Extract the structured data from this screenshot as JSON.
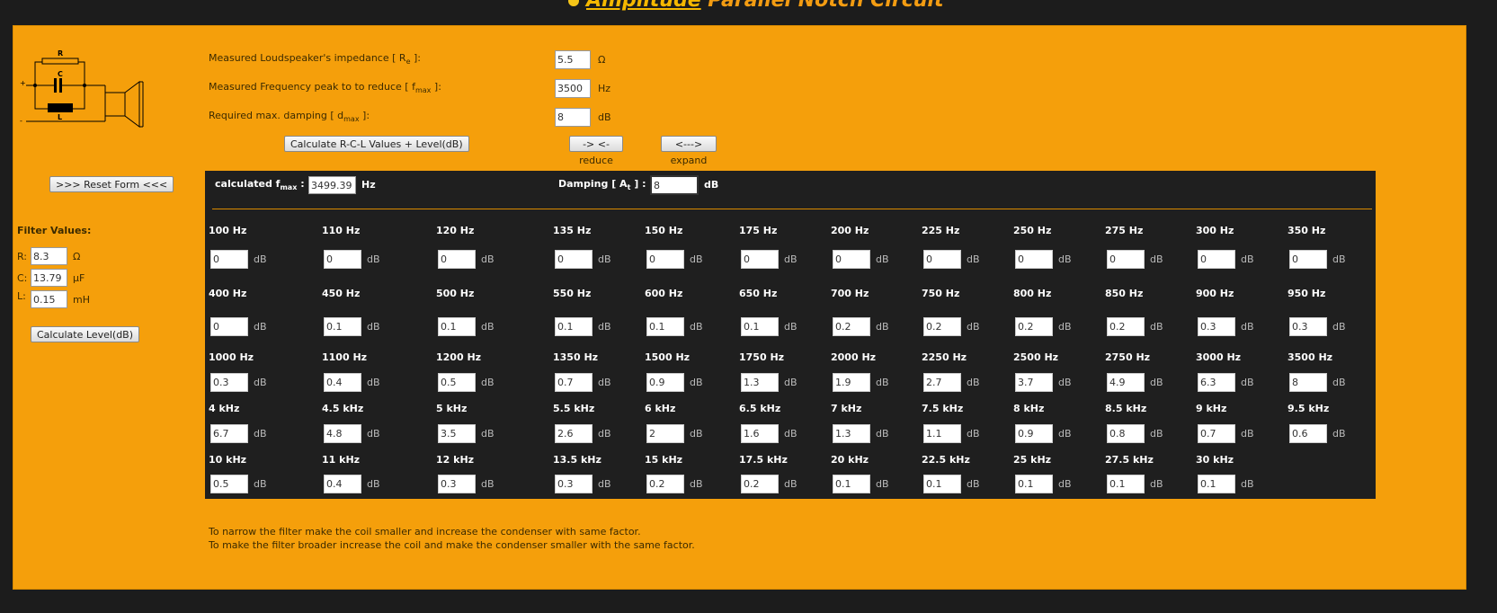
{
  "title": {
    "prefix": "Amplitude",
    "rest": " Parallel Notch Circuit"
  },
  "schematic": {
    "r": "R",
    "c": "C",
    "l": "L",
    "plus": "+",
    "minus": "-"
  },
  "inputs": {
    "impedance": {
      "label": "Measured Loudspeaker's impedance [ R",
      "sub": "e",
      "suffix": " ]:",
      "value": "5.5",
      "unit": "Ω"
    },
    "freq": {
      "label": "Measured Frequency peak to to reduce [ f",
      "sub": "max",
      "suffix": " ]:",
      "value": "3500",
      "unit": "Hz"
    },
    "damping": {
      "label": "Required max. damping [ d",
      "sub": "max",
      "suffix": " ]:",
      "value": "8",
      "unit": "dB"
    }
  },
  "buttons": {
    "calc_rcl": "Calculate R-C-L Values + Level(dB)",
    "reduce": "-> <-",
    "reduce_label": "reduce",
    "expand": "<--->",
    "expand_label": "expand",
    "reset": ">>> Reset Form <<<",
    "calc_level": "Calculate Level(dB)"
  },
  "filter": {
    "heading": "Filter Values:",
    "r": {
      "label": "R:",
      "value": "8.3",
      "unit": "Ω"
    },
    "c": {
      "label": "C:",
      "value": "13.79",
      "unit": "µF"
    },
    "l": {
      "label": "L:",
      "value": "0.15",
      "unit": "mH"
    }
  },
  "result": {
    "fmax_label": "calculated f",
    "fmax_sub": "max",
    "fmax_colon": " :",
    "fmax_value": "3499.39",
    "fmax_unit": "Hz",
    "damp_label": "Damping [ A",
    "damp_sub": "t",
    "damp_suffix": " ] :",
    "damp_value": "8",
    "damp_unit": "dB"
  },
  "db_unit": "dB",
  "grid": [
    [
      [
        "100 Hz",
        "0"
      ],
      [
        "110 Hz",
        "0"
      ],
      [
        "120 Hz",
        "0"
      ],
      [
        "135 Hz",
        "0"
      ],
      [
        "150 Hz",
        "0"
      ],
      [
        "175 Hz",
        "0"
      ],
      [
        "200 Hz",
        "0"
      ],
      [
        "225 Hz",
        "0"
      ],
      [
        "250 Hz",
        "0"
      ],
      [
        "275 Hz",
        "0"
      ],
      [
        "300 Hz",
        "0"
      ],
      [
        "350 Hz",
        "0"
      ]
    ],
    [
      [
        "400 Hz",
        "0"
      ],
      [
        "450 Hz",
        "0.1"
      ],
      [
        "500 Hz",
        "0.1"
      ],
      [
        "550 Hz",
        "0.1"
      ],
      [
        "600 Hz",
        "0.1"
      ],
      [
        "650 Hz",
        "0.1"
      ],
      [
        "700 Hz",
        "0.2"
      ],
      [
        "750 Hz",
        "0.2"
      ],
      [
        "800 Hz",
        "0.2"
      ],
      [
        "850 Hz",
        "0.2"
      ],
      [
        "900 Hz",
        "0.3"
      ],
      [
        "950 Hz",
        "0.3"
      ]
    ],
    [
      [
        "1000 Hz",
        "0.3"
      ],
      [
        "1100 Hz",
        "0.4"
      ],
      [
        "1200 Hz",
        "0.5"
      ],
      [
        "1350 Hz",
        "0.7"
      ],
      [
        "1500 Hz",
        "0.9"
      ],
      [
        "1750 Hz",
        "1.3"
      ],
      [
        "2000 Hz",
        "1.9"
      ],
      [
        "2250 Hz",
        "2.7"
      ],
      [
        "2500 Hz",
        "3.7"
      ],
      [
        "2750 Hz",
        "4.9"
      ],
      [
        "3000 Hz",
        "6.3"
      ],
      [
        "3500 Hz",
        "8"
      ]
    ],
    [
      [
        "4 kHz",
        "6.7"
      ],
      [
        "4.5 kHz",
        "4.8"
      ],
      [
        "5 kHz",
        "3.5"
      ],
      [
        "5.5 kHz",
        "2.6"
      ],
      [
        "6 kHz",
        "2"
      ],
      [
        "6.5 kHz",
        "1.6"
      ],
      [
        "7 kHz",
        "1.3"
      ],
      [
        "7.5 kHz",
        "1.1"
      ],
      [
        "8 kHz",
        "0.9"
      ],
      [
        "8.5 kHz",
        "0.8"
      ],
      [
        "9 kHz",
        "0.7"
      ],
      [
        "9.5 kHz",
        "0.6"
      ]
    ],
    [
      [
        "10 kHz",
        "0.5"
      ],
      [
        "11 kHz",
        "0.4"
      ],
      [
        "12 kHz",
        "0.3"
      ],
      [
        "13.5 kHz",
        "0.3"
      ],
      [
        "15 kHz",
        "0.2"
      ],
      [
        "17.5 kHz",
        "0.2"
      ],
      [
        "20 kHz",
        "0.1"
      ],
      [
        "22.5 kHz",
        "0.1"
      ],
      [
        "25 kHz",
        "0.1"
      ],
      [
        "27.5 kHz",
        "0.1"
      ],
      [
        "30 kHz",
        "0.1"
      ]
    ]
  ],
  "notes": [
    "To narrow the filter make the coil smaller and increase the condenser with same factor.",
    "To make the filter broader increase the coil and make the condenser smaller with the same factor."
  ]
}
